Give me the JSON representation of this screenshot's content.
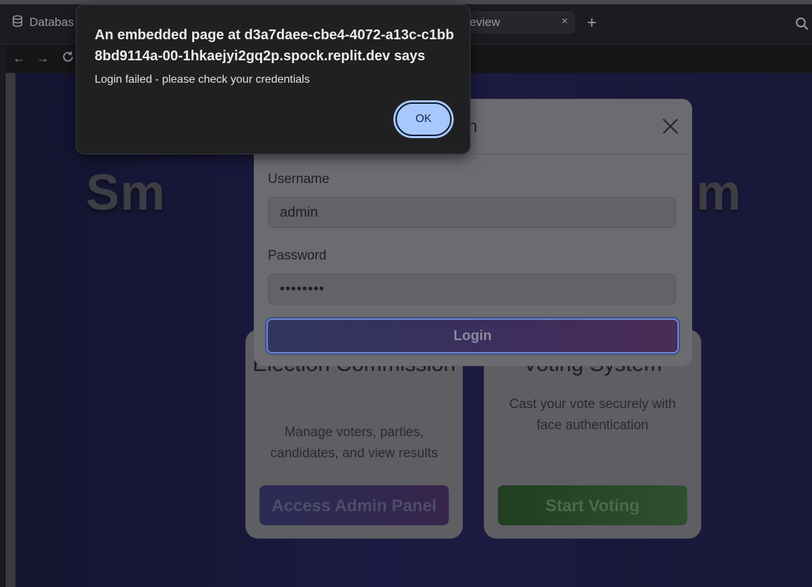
{
  "ide": {
    "tabs": [
      {
        "label": "Databas",
        "icon": "database-icon"
      },
      {
        "label": "review",
        "icon": "preview-icon"
      }
    ],
    "add_tab_symbol": "+",
    "close_symbol": "×",
    "nav": {
      "back": "←",
      "forward": "→"
    }
  },
  "page": {
    "hero_title": "Sm                                    m",
    "admin_card": {
      "title": "Election Commission",
      "description": "Manage voters, parties, candidates, and view results",
      "button": "Access Admin Panel"
    },
    "voter_card": {
      "title": "Voting System",
      "description": "Cast your vote securely with face authentication",
      "button": "Start Voting"
    }
  },
  "login_modal": {
    "title": "in",
    "username_label": "Username",
    "username_value": "admin",
    "password_label": "Password",
    "password_value": "••••••••",
    "submit_label": "Login"
  },
  "alert": {
    "title": "An embedded page at d3a7daee-cbe4-4072-a13c-c1bb8bd9114a-00-1hkaejyi2gq2p.spock.replit.dev says",
    "message": "Login failed - please check your credentials",
    "ok_label": "OK"
  }
}
